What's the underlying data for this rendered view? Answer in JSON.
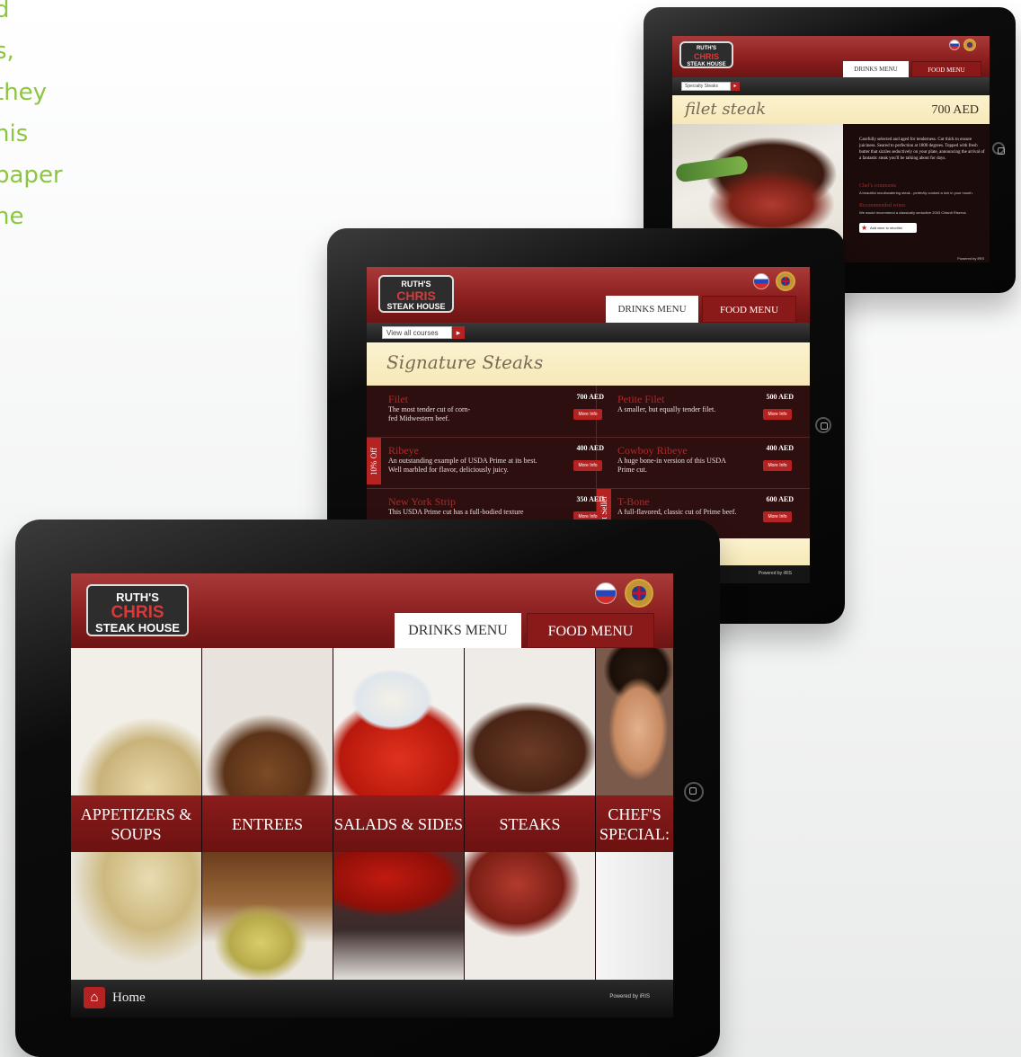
{
  "marketing_text": [
    "d",
    "s,",
    "they",
    "his",
    "paper",
    "he"
  ],
  "brand": {
    "line1": "RUTH'S",
    "line2": "CHRIS",
    "line3": "STEAK HOUSE"
  },
  "tabs": {
    "drinks": "DRINKS MENU",
    "food": "FOOD MENU"
  },
  "powered_by": "Powered by iRIS",
  "back_tablet": {
    "crumb": "Specialty Steaks",
    "dish_title": "filet steak",
    "price": "700 AED",
    "description": "Carefully selected and aged for tenderness. Cut thick to ensure juiciness. Seared to perfection at 1800 degrees. Topped with fresh butter that sizzles seductively on your plate, announcing the arrival of a fantastic steak you'll be talking about for days.",
    "chef_heading": "Chef's comments",
    "chef_text": "A beautiful mouthwatering steak - perfectly cooked a rich in your mouth.",
    "wine_heading": "Recommended wines",
    "wine_text": "We would recommend a classically seductive 2003 Chianti Riserva.",
    "add_wine": "Add wine to shortlist"
  },
  "middle_tablet": {
    "crumb": "View all courses",
    "section_title": "Signature Steaks",
    "badges": {
      "discount": "10% Off",
      "seller": "Best Seller"
    },
    "more_label": "More Info",
    "items_left": [
      {
        "name": "Filet",
        "desc": "The most tender cut of corn-fed Midwestern beef.",
        "price": "700 AED"
      },
      {
        "name": "Ribeye",
        "desc": "An outstanding example of USDA Prime at its best. Well marbled for flavor, deliciously juicy.",
        "price": "400 AED"
      },
      {
        "name": "New York Strip",
        "desc": "This USDA Prime cut has a full-bodied texture",
        "price": "350 AED"
      }
    ],
    "items_right": [
      {
        "name": "Petite Filet",
        "desc": "A smaller, but equally tender filet.",
        "price": "500 AED"
      },
      {
        "name": "Cowboy Ribeye",
        "desc": "A huge bone-in version of this USDA Prime cut.",
        "price": "400 AED"
      },
      {
        "name": "T-Bone",
        "desc": "A full-flavored, classic cut of Prime beef.",
        "price": "600 AED"
      }
    ]
  },
  "front_tablet": {
    "categories": [
      {
        "label": "APPETIZERS & SOUPS",
        "line1": "APPETIZERS &",
        "line2": "SOUPS"
      },
      {
        "label": "ENTREES",
        "line1": "ENTREES",
        "line2": ""
      },
      {
        "label": "SALADS & SIDES",
        "line1": "SALADS & SIDES",
        "line2": ""
      },
      {
        "label": "STEAKS",
        "line1": "STEAKS",
        "line2": ""
      },
      {
        "label": "CHEF'S SPECIALS",
        "line1": "CHEF'S",
        "line2": "SPECIAL:"
      }
    ],
    "home_label": "Home"
  },
  "colors": {
    "accent": "#8c1f1f",
    "marketing_green": "#8cc63f",
    "cream": "#f6e8b8"
  }
}
